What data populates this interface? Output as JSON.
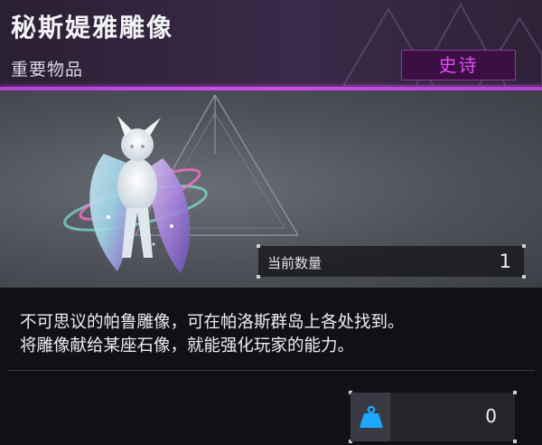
{
  "item": {
    "name": "秘斯媞雅雕像",
    "category": "重要物品",
    "rarity": "史诗"
  },
  "quantity": {
    "label": "当前数量",
    "value": "1"
  },
  "description": "不可思议的帕鲁雕像，可在帕洛斯群岛上各处找到。\n将雕像献给某座石像，就能强化玩家的能力。",
  "weight": {
    "value": "0",
    "icon": "weight-icon"
  },
  "colors": {
    "accent": "#c044e6",
    "rarity_text": "#e24af5",
    "rarity_bg": "#3b0f44",
    "weight_icon": "#1ea7ff"
  }
}
